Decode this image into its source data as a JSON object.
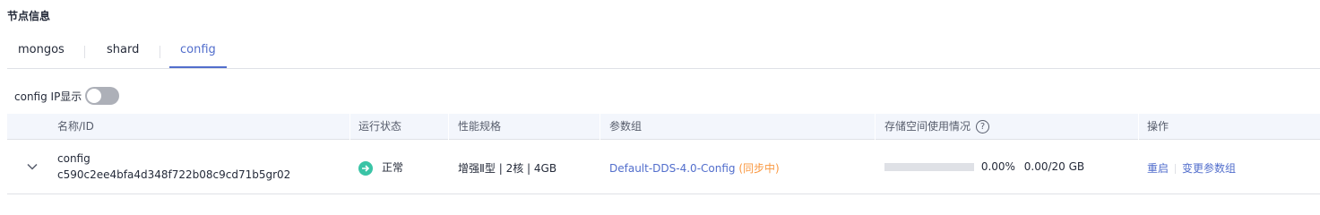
{
  "section_title": "节点信息",
  "tabs": [
    {
      "label": "mongos",
      "active": false
    },
    {
      "label": "shard",
      "active": false
    },
    {
      "label": "config",
      "active": true
    }
  ],
  "ip_toggle": {
    "label": "config IP显示",
    "on": false
  },
  "table": {
    "headers": {
      "name": "名称/ID",
      "status": "运行状态",
      "spec": "性能规格",
      "param_group": "参数组",
      "storage": "存储空间使用情况",
      "actions": "操作"
    },
    "rows": [
      {
        "name": "config",
        "id": "c590c2ee4bfa4d348f722b08c9cd71b5gr02",
        "status": "正常",
        "spec": "增强Ⅱ型 | 2核 | 4GB",
        "param_group": "Default-DDS-4.0-Config",
        "param_group_state": "(同步中)",
        "storage_percent_text": "0.00%",
        "storage_used_fraction": 0,
        "storage_text": "0.00/20 GB",
        "action_restart": "重启",
        "action_change_params": "变更参数组"
      }
    ]
  },
  "colors": {
    "accent": "#526ecc",
    "status_ok": "#3ac4a6",
    "sync": "#fa9841"
  }
}
